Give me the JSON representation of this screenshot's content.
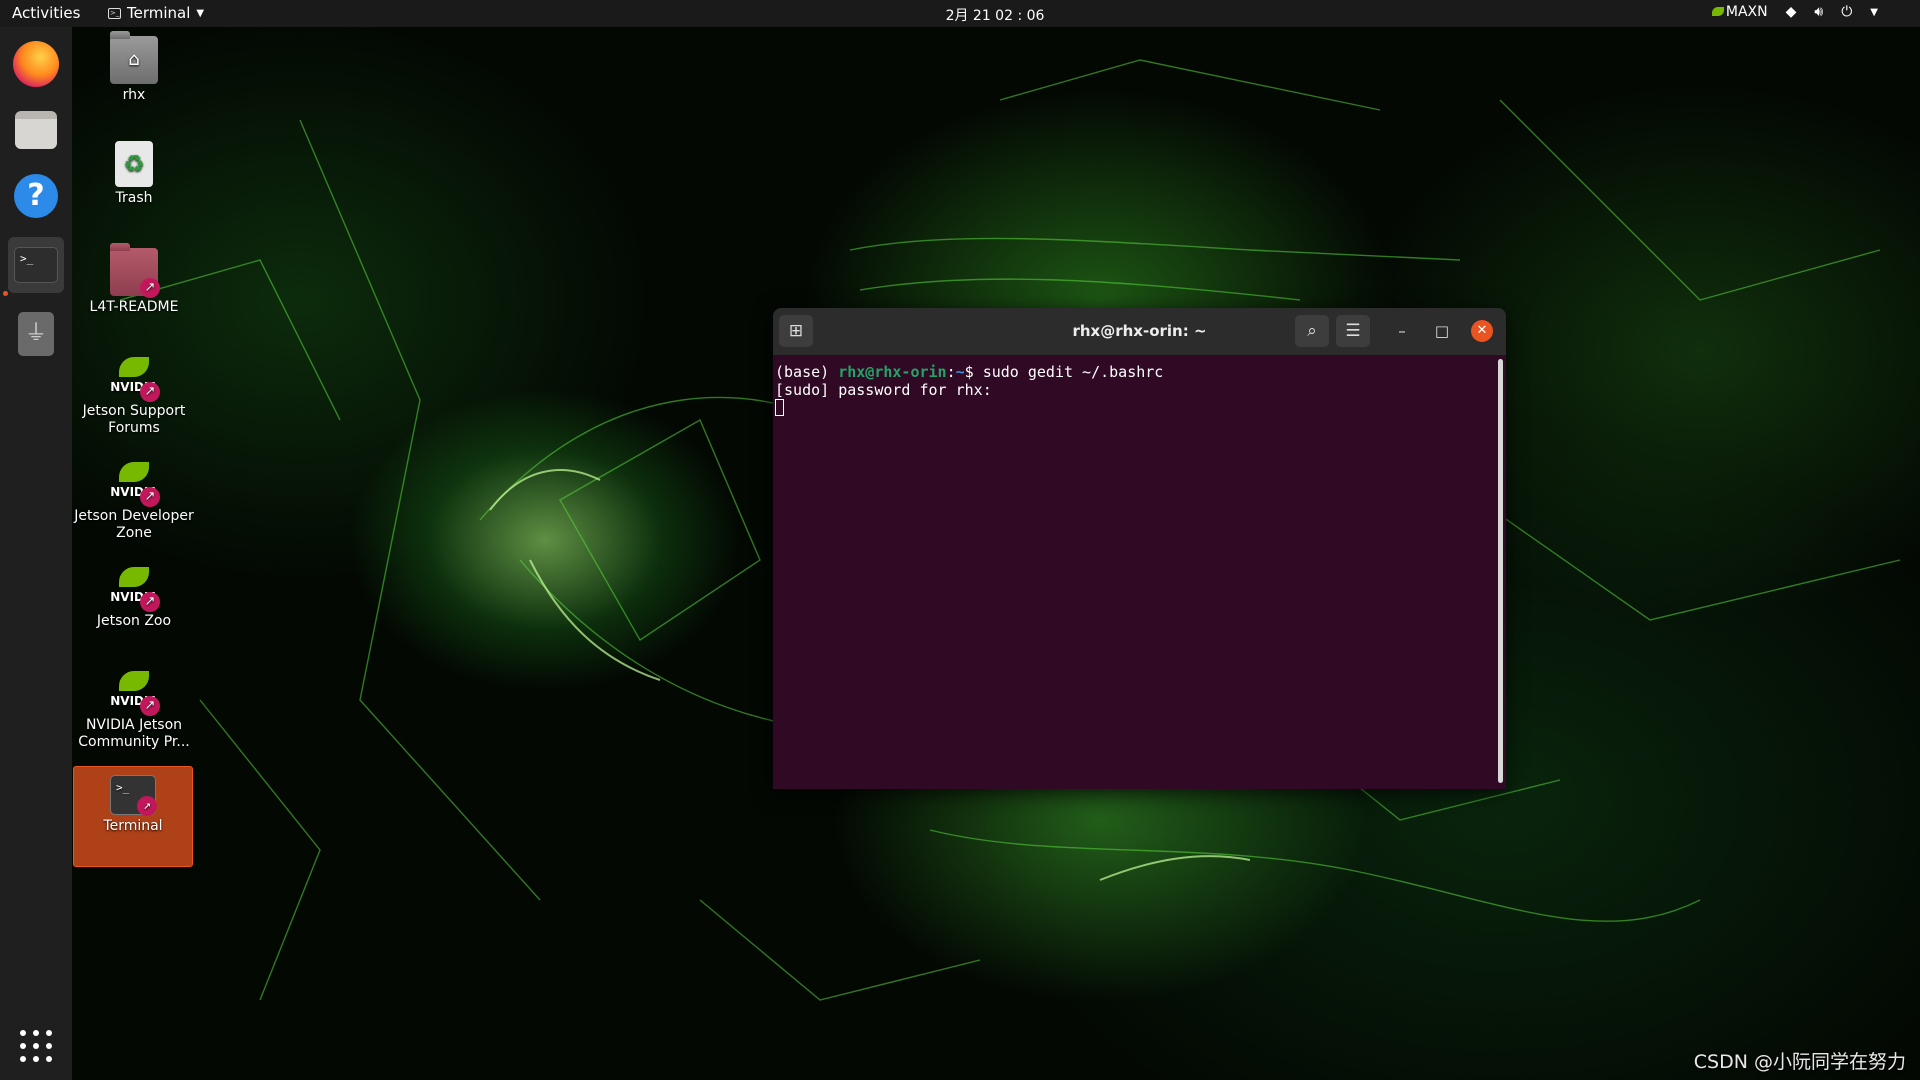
{
  "topbar": {
    "activities": "Activities",
    "app_name": "Terminal",
    "clock": "2月 21  02 : 06",
    "power_mode": "MAXN"
  },
  "dock": {
    "items": [
      "firefox-icon",
      "files-icon",
      "help-icon",
      "terminal-icon",
      "usb-icon"
    ],
    "active": "terminal-icon"
  },
  "desktop": {
    "icons": [
      {
        "label": "rhx"
      },
      {
        "label": "Trash"
      },
      {
        "label": "L4T-README"
      },
      {
        "label": "Jetson Support Forums"
      },
      {
        "label": "Jetson Developer Zone"
      },
      {
        "label": "Jetson Zoo"
      },
      {
        "label": "NVIDIA Jetson Community Pr..."
      },
      {
        "label": "Terminal"
      }
    ]
  },
  "terminal": {
    "title": "rhx@rhx-orin: ~",
    "lines": {
      "prompt_env": "(base) ",
      "prompt_user": "rhx@rhx-orin",
      "prompt_sep": ":",
      "prompt_path": "~",
      "prompt_end": "$ ",
      "command": "sudo gedit ~/.bashrc",
      "sudo_prompt": "[sudo] password for rhx: "
    }
  },
  "watermark": "CSDN @小阮同学在努力",
  "colors": {
    "terminal_bg": "#300a24",
    "accent": "#e95420",
    "nvidia_green": "#76b900"
  }
}
